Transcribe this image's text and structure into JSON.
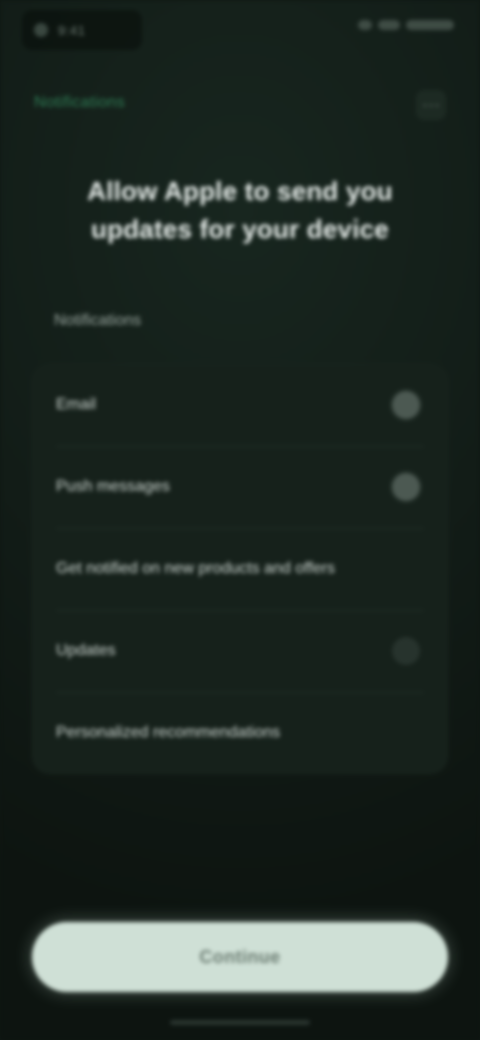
{
  "status_bar": {
    "time": "9:41",
    "right_indicators": [
      "signal-icon",
      "wifi-icon",
      "battery-icon"
    ]
  },
  "top_bar": {
    "back_label": "Notifications",
    "menu_icon": "more-icon"
  },
  "headline": "Allow Apple to send you updates for your device",
  "section_label": "Notifications",
  "settings": {
    "rows": [
      {
        "label": "Email",
        "control": "toggle",
        "on": true
      },
      {
        "label": "Push messages",
        "control": "toggle",
        "on": true
      },
      {
        "label": "Get notified on new products and offers",
        "control": "none"
      },
      {
        "label": "Updates",
        "control": "toggle",
        "on": false
      },
      {
        "label": "Personalized recommendations",
        "control": "none"
      }
    ]
  },
  "cta": {
    "label": "Continue"
  },
  "colors": {
    "background": "#121c17",
    "card": "#16211b",
    "accent": "#2f7d55",
    "cta_background": "#cfe0d6"
  }
}
